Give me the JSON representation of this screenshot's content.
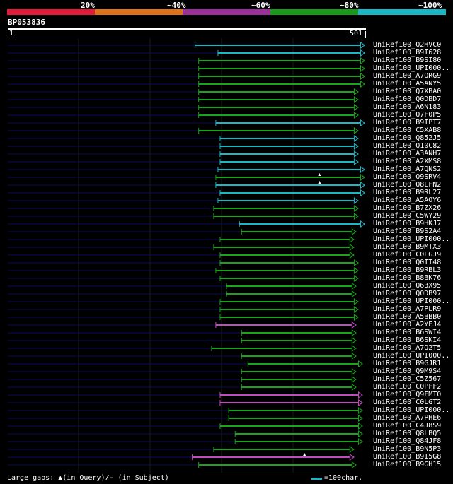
{
  "legend": [
    {
      "label": "20%",
      "color": "#e41a3a"
    },
    {
      "label": "~40%",
      "color": "#e0721a"
    },
    {
      "label": "~60%",
      "color": "#9c2f99"
    },
    {
      "label": "~80%",
      "color": "#1a9a1a"
    },
    {
      "label": "~100%",
      "color": "#19b8c7"
    }
  ],
  "title": "BP053836",
  "ruler": {
    "start": "1",
    "end": "501"
  },
  "colors": {
    "cyan": "#19b8c7",
    "green": "#1aa41a",
    "magenta": "#c04cc0",
    "navy": "#0a0a5a"
  },
  "hits": [
    {
      "name": "UniRef100_Q2HVC0",
      "start": 263,
      "end": 501,
      "color": "cyan"
    },
    {
      "name": "UniRef100_B9I628",
      "start": 295,
      "end": 501,
      "color": "cyan"
    },
    {
      "name": "UniRef100_B9SI80",
      "start": 268,
      "end": 501,
      "color": "green"
    },
    {
      "name": "UniRef100_UPI000..",
      "start": 268,
      "end": 501,
      "color": "green"
    },
    {
      "name": "UniRef100_A7QRG9",
      "start": 268,
      "end": 501,
      "color": "green"
    },
    {
      "name": "UniRef100_A5ANY5",
      "start": 268,
      "end": 501,
      "color": "green"
    },
    {
      "name": "UniRef100_Q7XBA0",
      "start": 268,
      "end": 492,
      "color": "green"
    },
    {
      "name": "UniRef100_Q0DBD7",
      "start": 268,
      "end": 492,
      "color": "green"
    },
    {
      "name": "UniRef100_A6N183",
      "start": 268,
      "end": 492,
      "color": "green"
    },
    {
      "name": "UniRef100_Q7F0P5",
      "start": 268,
      "end": 492,
      "color": "green"
    },
    {
      "name": "UniRef100_B9IPT7",
      "start": 292,
      "end": 501,
      "color": "cyan"
    },
    {
      "name": "UniRef100_C5XAB8",
      "start": 268,
      "end": 492,
      "color": "green"
    },
    {
      "name": "UniRef100_Q852J5",
      "start": 298,
      "end": 492,
      "color": "cyan"
    },
    {
      "name": "UniRef100_Q10C82",
      "start": 298,
      "end": 492,
      "color": "cyan"
    },
    {
      "name": "UniRef100_A3ANH7",
      "start": 298,
      "end": 492,
      "color": "cyan"
    },
    {
      "name": "UniRef100_A2XMS8",
      "start": 298,
      "end": 492,
      "color": "cyan"
    },
    {
      "name": "UniRef100_A7QNS2",
      "start": 295,
      "end": 501,
      "color": "cyan"
    },
    {
      "name": "UniRef100_Q9SRV4",
      "start": 292,
      "end": 501,
      "color": "green",
      "gap": 437
    },
    {
      "name": "UniRef100_Q8LFN2",
      "start": 292,
      "end": 501,
      "color": "cyan",
      "gap": 437
    },
    {
      "name": "UniRef100_B9RL27",
      "start": 298,
      "end": 501,
      "color": "cyan"
    },
    {
      "name": "UniRef100_A5AOY6",
      "start": 295,
      "end": 492,
      "color": "cyan"
    },
    {
      "name": "UniRef100_B7ZX26",
      "start": 289,
      "end": 492,
      "color": "green"
    },
    {
      "name": "UniRef100_C5WY29",
      "start": 289,
      "end": 492,
      "color": "green"
    },
    {
      "name": "UniRef100_B9HKJ7",
      "start": 325,
      "end": 501,
      "color": "cyan"
    },
    {
      "name": "UniRef100_B9S2A4",
      "start": 328,
      "end": 489,
      "color": "green"
    },
    {
      "name": "UniRef100_UPI000..",
      "start": 298,
      "end": 486,
      "color": "green"
    },
    {
      "name": "UniRef100_B9MTX3",
      "start": 289,
      "end": 486,
      "color": "green"
    },
    {
      "name": "UniRef100_C0LGJ9",
      "start": 298,
      "end": 486,
      "color": "green"
    },
    {
      "name": "UniRef100_Q0IT48",
      "start": 298,
      "end": 492,
      "color": "green"
    },
    {
      "name": "UniRef100_B9RBL3",
      "start": 292,
      "end": 492,
      "color": "green"
    },
    {
      "name": "UniRef100_B8BK76",
      "start": 298,
      "end": 492,
      "color": "green"
    },
    {
      "name": "UniRef100_Q63X95",
      "start": 307,
      "end": 489,
      "color": "green"
    },
    {
      "name": "UniRef100_Q0DB97",
      "start": 307,
      "end": 489,
      "color": "green"
    },
    {
      "name": "UniRef100_UPI000..",
      "start": 298,
      "end": 492,
      "color": "green"
    },
    {
      "name": "UniRef100_A7PLR9",
      "start": 298,
      "end": 492,
      "color": "green"
    },
    {
      "name": "UniRef100_A5BBB0",
      "start": 298,
      "end": 492,
      "color": "green"
    },
    {
      "name": "UniRef100_A2YEJ4",
      "start": 292,
      "end": 489,
      "color": "magenta"
    },
    {
      "name": "UniRef100_B6SWI4",
      "start": 328,
      "end": 489,
      "color": "green"
    },
    {
      "name": "UniRef100_B6SKI4",
      "start": 328,
      "end": 489,
      "color": "green"
    },
    {
      "name": "UniRef100_A7Q2T5",
      "start": 286,
      "end": 489,
      "color": "green"
    },
    {
      "name": "UniRef100_UPI000..",
      "start": 328,
      "end": 489,
      "color": "green"
    },
    {
      "name": "UniRef100_B9GJR1",
      "start": 337,
      "end": 498,
      "color": "green"
    },
    {
      "name": "UniRef100_Q9M9S4",
      "start": 328,
      "end": 489,
      "color": "green"
    },
    {
      "name": "UniRef100_C5Z567",
      "start": 328,
      "end": 489,
      "color": "green"
    },
    {
      "name": "UniRef100_C0PFF2",
      "start": 328,
      "end": 489,
      "color": "green"
    },
    {
      "name": "UniRef100_Q9FMT0",
      "start": 298,
      "end": 498,
      "color": "magenta"
    },
    {
      "name": "UniRef100_C0LGT2",
      "start": 298,
      "end": 498,
      "color": "magenta"
    },
    {
      "name": "UniRef100_UPI000..",
      "start": 310,
      "end": 498,
      "color": "green"
    },
    {
      "name": "UniRef100_A7PHE6",
      "start": 310,
      "end": 498,
      "color": "green"
    },
    {
      "name": "UniRef100_C4J8S9",
      "start": 298,
      "end": 498,
      "color": "green"
    },
    {
      "name": "UniRef100_Q8LBQ5",
      "start": 319,
      "end": 498,
      "color": "green"
    },
    {
      "name": "UniRef100_Q84JF8",
      "start": 319,
      "end": 498,
      "color": "green"
    },
    {
      "name": "UniRef100_B9N5P3",
      "start": 289,
      "end": 486,
      "color": "green"
    },
    {
      "name": "UniRef100_B9I5G8",
      "start": 259,
      "end": 486,
      "color": "magenta",
      "gap": 416
    },
    {
      "name": "UniRef100_B9GH15",
      "start": 268,
      "end": 489,
      "color": "green"
    }
  ],
  "footer": {
    "gaps_label": "Large gaps:",
    "in_query": "▲(in Query)/",
    "in_subject": "- (in Subject)",
    "scale_label": "=100char."
  }
}
